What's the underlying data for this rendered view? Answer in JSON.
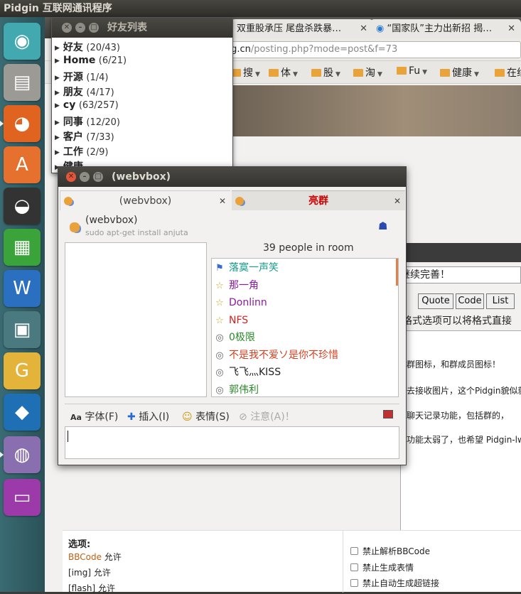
{
  "topbar": {
    "title": "Pidgin 互联网通讯程序"
  },
  "launcher": {
    "items": [
      {
        "name": "ubuntu-home-icon",
        "glyph": "◉",
        "color": "#43a9b0"
      },
      {
        "name": "file-manager-icon",
        "glyph": "▤",
        "color": "#9c9a95"
      },
      {
        "name": "firefox-icon",
        "glyph": "◕",
        "color": "#e06420"
      },
      {
        "name": "software-center-icon",
        "glyph": "A",
        "color": "#e6702d"
      },
      {
        "name": "qq-penguin-icon",
        "glyph": "◒",
        "color": "#333333"
      },
      {
        "name": "libreoffice-icon",
        "glyph": "▦",
        "color": "#3aa43a"
      },
      {
        "name": "wps-writer-icon",
        "glyph": "W",
        "color": "#2b6fc0"
      },
      {
        "name": "workspace-switcher-icon",
        "glyph": "▣",
        "color": "#4a7a80"
      },
      {
        "name": "game-icon",
        "glyph": "G",
        "color": "#e4b43a"
      },
      {
        "name": "virtualbox-icon",
        "glyph": "◆",
        "color": "#1f6fb5"
      },
      {
        "name": "pidgin-icon",
        "glyph": "◍",
        "color": "#8a6fb0"
      },
      {
        "name": "app-window-icon",
        "glyph": "▭",
        "color": "#9b3aa8"
      }
    ]
  },
  "browser": {
    "tabs": [
      {
        "label": "双重股承压 尾盘杀跌暴…"
      },
      {
        "label": "“国家队”主力出新招 揭…"
      }
    ],
    "url_domain": "rg.cn",
    "url_path": "/posting.php?mode=post&f=73",
    "bookmarks": [
      "搜",
      "体",
      "股",
      "淘",
      "Fu",
      "健康",
      "在线"
    ],
    "reply_text": "不错，希望继续完善！",
    "format_buttons": [
      "Quote",
      "Code",
      "List"
    ],
    "format_hint": "格式选项可以将格式直接",
    "editor_lines": [
      "群图标，和群成员图标！",
      "去接收图片，这个Pidgin貌似就",
      "聊天记录功能，包括群的，",
      "功能太弱了，也希望 Pidgin-lwq"
    ],
    "options_title": "选项:",
    "options_left": [
      {
        "label": "BBCode",
        "suffix": " 允许"
      },
      {
        "label": "[img]",
        "suffix": " 允许"
      },
      {
        "label": "[flash]",
        "suffix": " 允许"
      }
    ],
    "options_right": [
      "禁止解析BBCode",
      "禁止生成表情",
      "禁止自动生成超链接"
    ]
  },
  "buddy_list": {
    "title": "好友列表",
    "groups": [
      {
        "name": "好友",
        "count": "(20/43)"
      },
      {
        "name": "Home",
        "count": "(6/21)"
      },
      {
        "name": "开源",
        "count": "(1/4)"
      },
      {
        "name": "朋友",
        "count": "(4/17)"
      },
      {
        "name": "cy",
        "count": "(63/257)"
      },
      {
        "name": "同事",
        "count": "(12/20)"
      },
      {
        "name": "客户",
        "count": "(7/33)"
      },
      {
        "name": "工作",
        "count": "(2/9)"
      },
      {
        "name": "健康",
        "count": ""
      }
    ]
  },
  "chat": {
    "title": "(webvbox)",
    "tabs": [
      {
        "label": "(webvbox)",
        "color": "#444444"
      },
      {
        "label": "亮群",
        "color": "#cc0000"
      }
    ],
    "room_name": "(webvbox)",
    "room_topic": "sudo apt-get install anjuta",
    "people_count": "39 people in room",
    "members": [
      {
        "name": "落寞一声笑",
        "icon": "flag-icon",
        "glyph": "⚑",
        "color": "#1a9a8a",
        "icolor": "#3a6bd0"
      },
      {
        "name": "那一角",
        "icon": "star-icon",
        "glyph": "☆",
        "color": "#8a1aa0",
        "icolor": "#d0a020"
      },
      {
        "name": "Donlinn",
        "icon": "star-icon",
        "glyph": "☆",
        "color": "#8a1aa0",
        "icolor": "#d0a020"
      },
      {
        "name": "NFS",
        "icon": "star-icon",
        "glyph": "☆",
        "color": "#d42020",
        "icolor": "#d0a020"
      },
      {
        "name": "0极限",
        "icon": "signal-icon",
        "glyph": "◎",
        "color": "#2a8a2a",
        "icolor": "#666666"
      },
      {
        "name": "不是我不爱ソ是你不珍惜",
        "icon": "signal-icon",
        "glyph": "◎",
        "color": "#d04020",
        "icolor": "#666666"
      },
      {
        "name": "飞飞灬KISS",
        "icon": "signal-icon",
        "glyph": "◎",
        "color": "#222222",
        "icolor": "#666666"
      },
      {
        "name": "郭伟利",
        "icon": "signal-icon",
        "glyph": "◎",
        "color": "#2a8a2a",
        "icolor": "#666666"
      }
    ],
    "toolbar": {
      "font": "字体(F)",
      "insert": "插入(I)",
      "smiley": "表情(S)",
      "attention": "注意(A)！"
    }
  }
}
